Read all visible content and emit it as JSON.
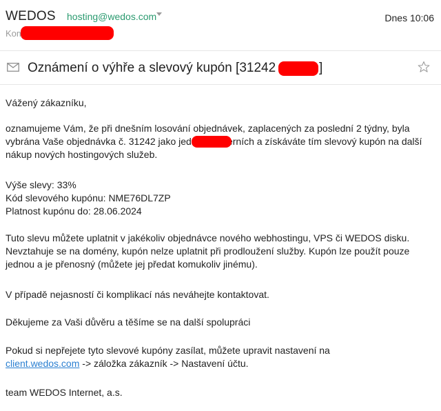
{
  "header": {
    "sender_name": "WEDOS",
    "sender_email": "hosting@wedos.com",
    "date": "Dnes 10:06",
    "to_label": "Komu:"
  },
  "subject": {
    "text_prefix": "Oznámení o výhře a slevový kupón [31242",
    "text_suffix": "]"
  },
  "icons": {
    "envelope": "envelope-icon",
    "star": "star-icon",
    "caret": "chevron-down-icon"
  },
  "colors": {
    "link": "#2a7fd1",
    "sender_email": "#2a9a6f",
    "redaction": "#ff0000"
  },
  "body": {
    "greeting": "Vážený zákazníku,",
    "p1_part1": "oznamujeme Vám, že při dnešním losování objednávek, zaplacených za poslední 2 týdny, byla vybrána Vaše objednávka č. 31242",
    "p1_part2": " jako jedna z výherních a získáváte tím slevový kupón na další nákup nových hostingových služeb.",
    "discount": "Výše slevy: 33%",
    "coupon_code": "Kód slevového kupónu: NME76DL7ZP",
    "validity": "Platnost kupónu do: 28.06.2024",
    "p2": "Tuto slevu můžete uplatnit v jakékoliv objednávce nového webhostingu, VPS či WEDOS disku. Nevztahuje se na domény, kupón nelze uplatnit při prodloužení služby. Kupón lze použít pouze jednou a je přenosný (můžete jej předat komukoliv jinému).",
    "p3": "V případě nejasností či komplikací nás neváhejte kontaktovat.",
    "p4": "Děkujeme za Vaši důvěru a těšíme se na další spolupráci",
    "p5_part1": "Pokud si nepřejete tyto slevové kupóny zasílat, můžete upravit nastavení na",
    "p5_link": "client.wedos.com",
    "p5_part2": " -> záložka zákazník -> Nastavení účtu.",
    "signature": "team WEDOS Internet, a.s."
  }
}
